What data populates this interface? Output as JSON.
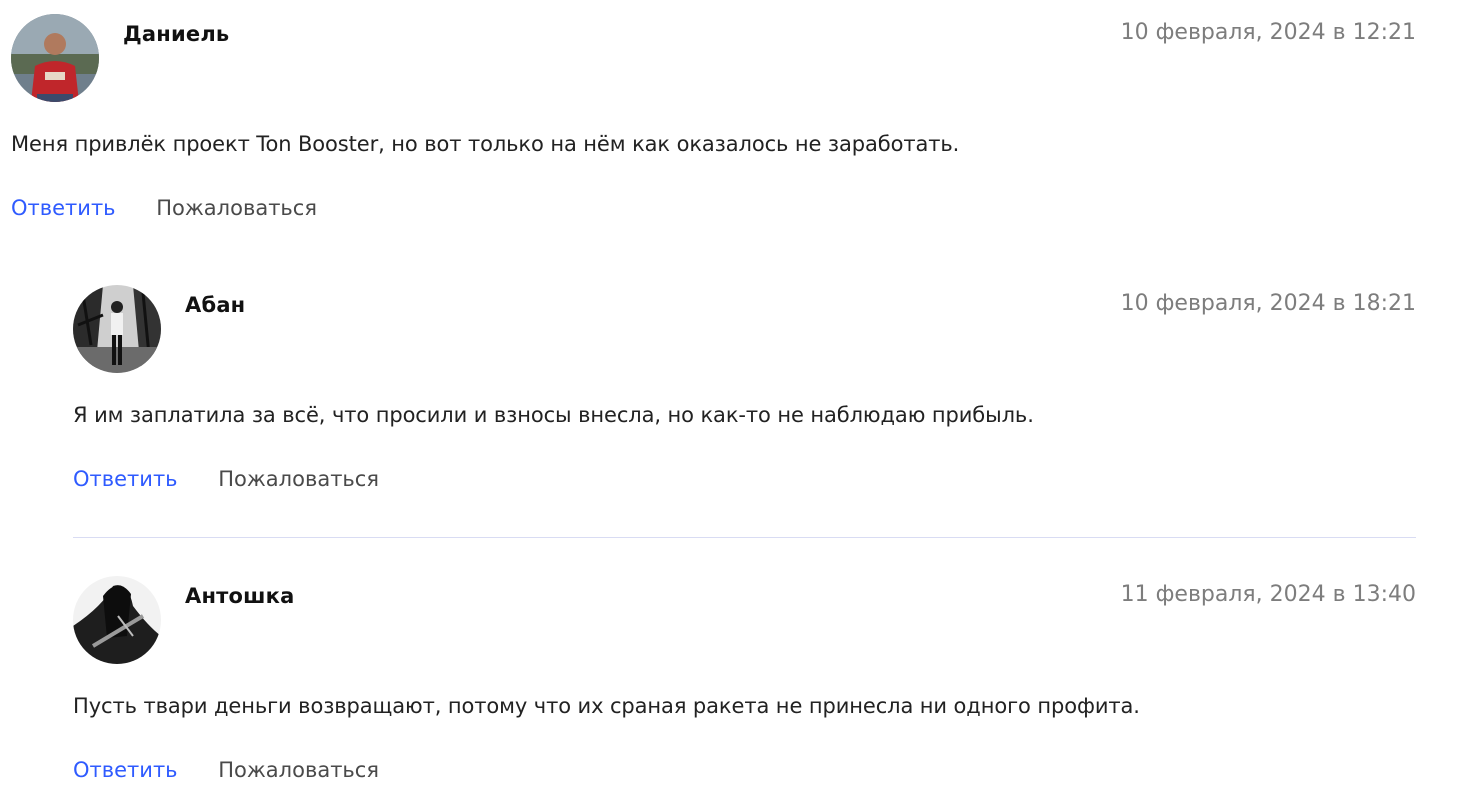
{
  "comments": [
    {
      "author": "Даниель",
      "date": "10 февраля, 2024 в 12:21",
      "text": "Меня привлёк проект Ton Booster, но вот только на нём как оказалось не заработать.",
      "reply_label": "Ответить",
      "report_label": "Пожаловаться"
    },
    {
      "author": "Абан",
      "date": "10 февраля, 2024 в 18:21",
      "text": "Я им заплатила за всё, что просили и взносы внесла, но как-то не наблюдаю прибыль.",
      "reply_label": "Ответить",
      "report_label": "Пожаловаться"
    },
    {
      "author": "Антошка",
      "date": "11 февраля, 2024 в 13:40",
      "text": "Пусть твари деньги возвращают, потому что их сраная ракета не принесла ни одного профита.",
      "reply_label": "Ответить",
      "report_label": "Пожаловаться"
    }
  ],
  "colors": {
    "reply_link": "#2f5bff",
    "date_text": "#7d7d7d",
    "divider": "#d9dcf3"
  }
}
